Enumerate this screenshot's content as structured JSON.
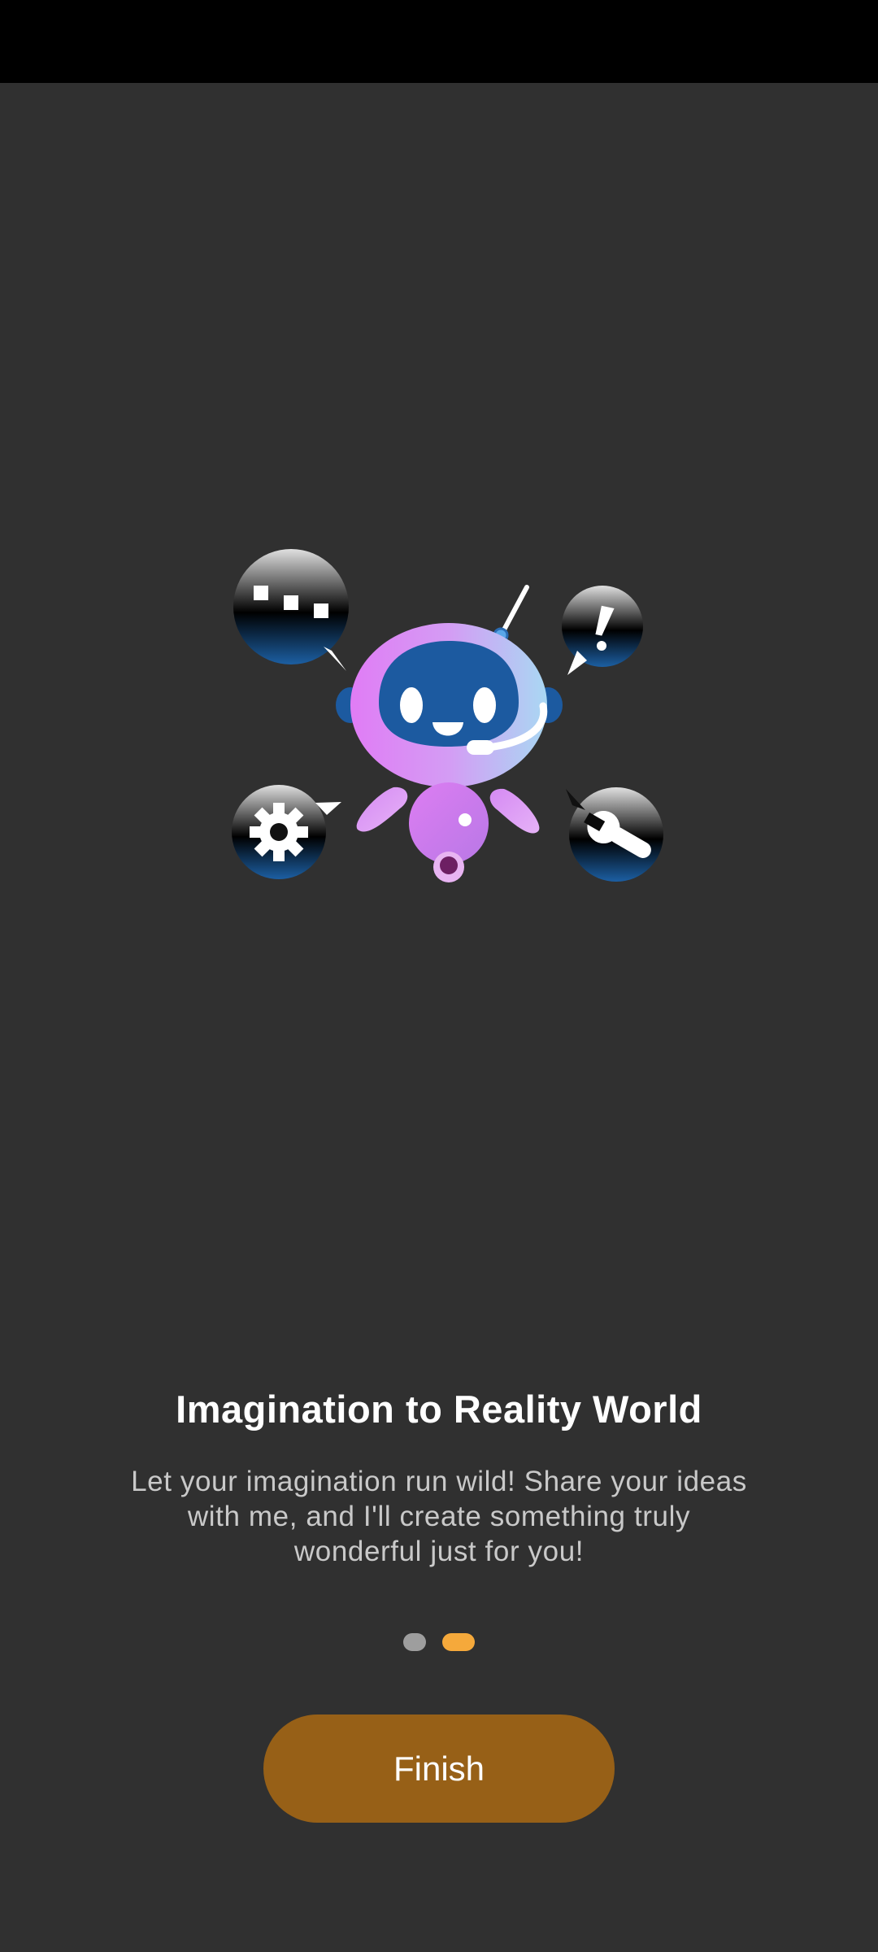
{
  "onboarding": {
    "title": "Imagination to Reality World",
    "description": "Let your imagination run wild! Share your ideas with me, and I'll create something truly wonderful just for you!",
    "pager": {
      "total_pages": 2,
      "current_page": 2
    },
    "finish_label": "Finish"
  },
  "illustration": {
    "icons": [
      "robot-icon",
      "chat-bubble-icon",
      "exclamation-bubble-icon",
      "gear-icon",
      "wrench-icon"
    ]
  },
  "colors": {
    "background": "#303030",
    "status_bar": "#000000",
    "accent": "#F5A93B",
    "button": "#976017",
    "dot_inactive": "#9E9E9E"
  }
}
